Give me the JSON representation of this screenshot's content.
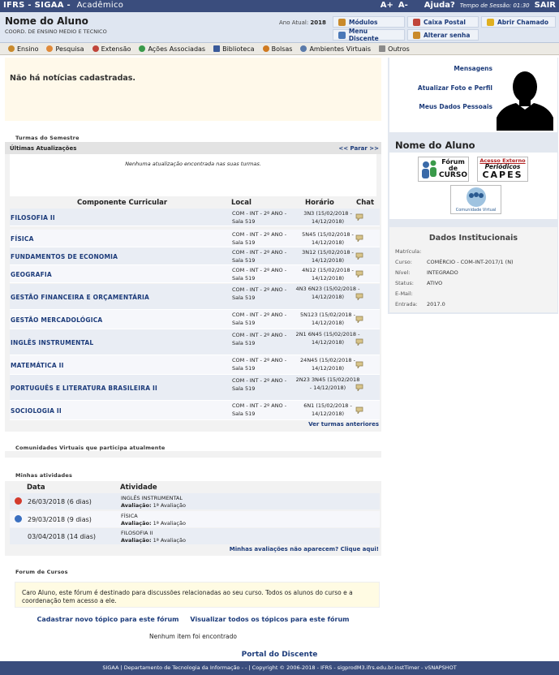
{
  "topbar": {
    "system": "IFRS - SIGAA -",
    "module": "Acadêmico",
    "font_larger": "A+",
    "font_smaller": "A-",
    "help": "Ajuda?",
    "session_label": "Tempo de Sessão: 01:30",
    "exit": "SAIR"
  },
  "header": {
    "user_name": "Nome do Aluno",
    "course": "COORD. DE ENSINO MEDIO E TECNICO",
    "year_label": "Ano Atual:",
    "year_value": "2018",
    "buttons": {
      "modulos": "Módulos",
      "caixa_postal": "Caixa Postal",
      "abrir_chamado": "Abrir Chamado",
      "menu_discente": "Menu Discente",
      "alterar_senha": "Alterar senha"
    }
  },
  "menu": [
    "Ensino",
    "Pesquisa",
    "Extensão",
    "Ações Associadas",
    "Biblioteca",
    "Bolsas",
    "Ambientes Virtuais",
    "Outros"
  ],
  "news": {
    "text": "Não há notícias cadastradas."
  },
  "turmas": {
    "section_title": "Turmas do Semestre",
    "updates_title": "Últimas Atualizações",
    "stop_link": "<< Parar >>",
    "no_updates": "Nenhuma atualização encontrada nas suas turmas.",
    "columns": {
      "componente": "Componente Curricular",
      "local": "Local",
      "horario": "Horário",
      "chat": "Chat"
    },
    "rows": [
      {
        "name": "FILOSOFIA II",
        "local": "COM - INT - 2º ANO - Sala 519",
        "horario": "3N3 (15/02/2018 - 14/12/2018)"
      },
      {
        "name": "FÍSICA",
        "local": "COM - INT - 2º ANO - Sala 519",
        "horario": "5N45 (15/02/2018 - 14/12/2018)"
      },
      {
        "name": "FUNDAMENTOS DE ECONOMIA",
        "local": "COM - INT - 2º ANO - Sala 519",
        "horario": "3N12 (15/02/2018 - 14/12/2018)"
      },
      {
        "name": "GEOGRAFIA",
        "local": "COM - INT - 2º ANO - Sala 519",
        "horario": "4N12 (15/02/2018 - 14/12/2018)"
      },
      {
        "name": "GESTÃO FINANCEIRA E ORÇAMENTÁRIA",
        "local": "COM - INT - 2º ANO - Sala 519",
        "horario": "4N3 6N23 (15/02/2018 - 14/12/2018)"
      },
      {
        "name": "GESTÃO MERCADOLÓGICA",
        "local": "COM - INT - 2º ANO - Sala 519",
        "horario": "5N123 (15/02/2018 - 14/12/2018)"
      },
      {
        "name": "INGLÊS INSTRUMENTAL",
        "local": "COM - INT - 2º ANO - Sala 519",
        "horario": "2N1 6N45 (15/02/2018 - 14/12/2018)"
      },
      {
        "name": "MATEMÁTICA II",
        "local": "COM - INT - 2º ANO - Sala 519",
        "horario": "24N45 (15/02/2018 - 14/12/2018)"
      },
      {
        "name": "PORTUGUÊS E LITERATURA BRASILEIRA II",
        "local": "COM - INT - 2º ANO - Sala 519",
        "horario": "2N23 3N45 (15/02/2018 - 14/12/2018)"
      },
      {
        "name": "SOCIOLOGIA II",
        "local": "COM - INT - 2º ANO - Sala 519",
        "horario": "6N1 (15/02/2018 - 14/12/2018)"
      }
    ],
    "previous_link": "Ver turmas anteriores"
  },
  "comunidades": {
    "title": "Comunidades Virtuais que participa atualmente"
  },
  "atividades": {
    "title": "Minhas atividades",
    "columns": {
      "data": "Data",
      "atividade": "Atividade"
    },
    "rows": [
      {
        "date": "26/03/2018 (6 dias)",
        "subject": "INGLÊS INSTRUMENTAL",
        "eval_label": "Avaliação:",
        "eval": "1ª Avaliação",
        "status": "overdue"
      },
      {
        "date": "29/03/2018 (9 dias)",
        "subject": "FÍSICA",
        "eval_label": "Avaliação:",
        "eval": "1ª Avaliação",
        "status": "info"
      },
      {
        "date": "03/04/2018 (14 dias)",
        "subject": "FILOSOFIA II",
        "eval_label": "Avaliação:",
        "eval": "1ª Avaliação",
        "status": "none"
      }
    ],
    "missing_link": "Minhas avaliações não aparecem? Clique aqui!"
  },
  "forum": {
    "title": "Forum de Cursos",
    "message": "Caro Aluno, este fórum é destinado para discussões relacionadas ao seu curso. Todos os alunos do curso e a coordenação tem acesso a ele.",
    "new_topic": "Cadastrar novo tópico para este fórum",
    "view_all": "Visualizar todos os tópicos para este fórum",
    "empty": "Nenhum item foi encontrado"
  },
  "portal_link": "Portal do Discente",
  "footer": "SIGAA | Departamento de Tecnologia da Informação - - | Copyright © 2006-2018 - IFRS - sigprodM3.ifrs.edu.br.instTimer - vSNAPSHOT",
  "right_panel": {
    "links": {
      "mensagens": "Mensagens",
      "atualizar_foto": "Atualizar Foto e Perfil",
      "dados_pessoais": "Meus Dados Pessoais"
    },
    "student_name": "Nome do Aluno",
    "logos": {
      "forum_line1": "Fórum",
      "forum_line2": "de",
      "forum_line3": "CURSO",
      "capes_line1": "Acesso Externo",
      "capes_line2": "Periódicos",
      "capes_line3": "CAPES",
      "comunidade": "Comunidade Virtual"
    },
    "dados": {
      "title": "Dados Institucionais",
      "fields": [
        {
          "label": "Matrícula:",
          "value": ""
        },
        {
          "label": "Curso:",
          "value": "COMÉRCIO - COM-INT-2017/1 (N)"
        },
        {
          "label": "Nível:",
          "value": "INTEGRADO"
        },
        {
          "label": "Status:",
          "value": "ATIVO"
        },
        {
          "label": "E-Mail:",
          "value": ""
        },
        {
          "label": "Entrada:",
          "value": "2017.0"
        }
      ]
    }
  },
  "colors": {
    "brand": "#3a4d7d",
    "link": "#1c3b7a",
    "row": "#e9edf4",
    "news_bg": "#fff9ea"
  }
}
